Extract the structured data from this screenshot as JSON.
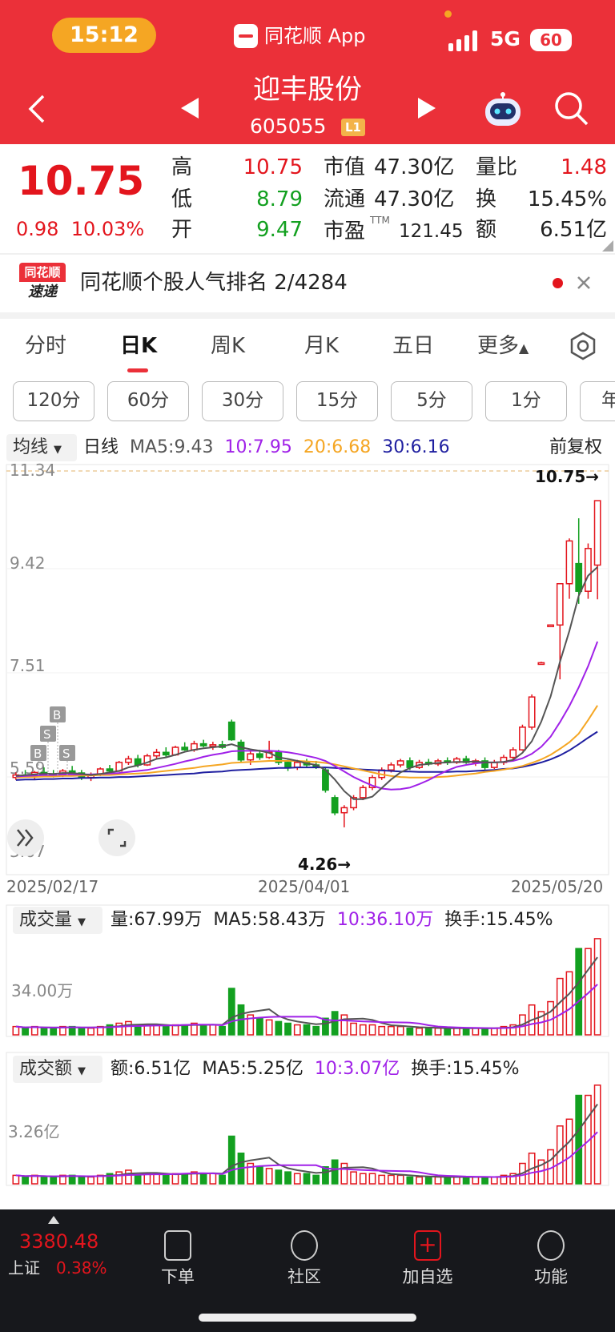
{
  "status_bar": {
    "time": "15:12",
    "app": "同花顺 App",
    "network": "5G",
    "battery": "60"
  },
  "header": {
    "name": "迎丰股份",
    "code": "605055",
    "level": "L1"
  },
  "quote": {
    "price": "10.75",
    "change": "0.98",
    "change_pct": "10.03%",
    "rows": [
      {
        "l1": "高",
        "v1": "10.75",
        "l2": "市值",
        "v2": "47.30亿",
        "l3": "量比",
        "v3": "1.48"
      },
      {
        "l1": "低",
        "v1": "8.79",
        "l2": "流通",
        "v2": "47.30亿",
        "l3": "换",
        "v3": "15.45%"
      },
      {
        "l1": "开",
        "v1": "9.47",
        "l2": "市盈",
        "l2sup": "TTM",
        "v2": "121.45",
        "l3": "额",
        "v3": "6.51亿"
      }
    ]
  },
  "banner": {
    "logo_top": "同花顺",
    "logo_bottom": "速递",
    "text": "同花顺个股人气排名 2/4284"
  },
  "tabs": [
    "分时",
    "日K",
    "周K",
    "月K",
    "五日",
    "更多"
  ],
  "periods": [
    "120分",
    "60分",
    "30分",
    "15分",
    "5分",
    "1分",
    "年"
  ],
  "ma_bar": {
    "selector": "均线",
    "type": "日线",
    "ma5": "MA5:9.43",
    "ma10": "10:7.95",
    "ma20": "20:6.68",
    "ma30": "30:6.16",
    "adjust": "前复权"
  },
  "price_chart": {
    "axis_labels": [
      "11.34",
      "9.42",
      "7.51",
      "5.59",
      "3.67"
    ],
    "max_label": "10.75→",
    "min_label": "4.26→",
    "dates": [
      "2025/02/17",
      "2025/04/01",
      "2025/05/20"
    ],
    "markers": [
      "B",
      "S",
      "B",
      "S"
    ]
  },
  "volume_panel": {
    "title": "成交量",
    "v": "量:67.99万",
    "ma5": "MA5:58.43万",
    "ma10": "10:36.10万",
    "turn": "换手:15.45%",
    "axis": "34.00万"
  },
  "amount_panel": {
    "title": "成交额",
    "v": "额:6.51亿",
    "ma5": "MA5:5.25亿",
    "ma10": "10:3.07亿",
    "turn": "换手:15.45%",
    "axis": "3.26亿"
  },
  "bottom_nav": {
    "index_value": "3380.48",
    "index_name": "上证",
    "index_pct": "0.38%",
    "items": [
      "下单",
      "社区",
      "加自选",
      "功能"
    ]
  },
  "colors": {
    "up": "#e3151d",
    "down": "#13a020",
    "ma5": "#555555",
    "ma10": "#a021e8",
    "ma20": "#f5a623",
    "ma30": "#1f1fa0",
    "header": "#eb3039"
  },
  "chart_data": {
    "type": "candlestick",
    "title": "迎丰股份 日K",
    "x_start": "2025/02/17",
    "x_end": "2025/05/20",
    "ylim": [
      3.67,
      11.34
    ],
    "ohlc": [
      [
        5.25,
        5.35,
        5.2,
        5.3
      ],
      [
        5.3,
        5.4,
        5.25,
        5.28
      ],
      [
        5.28,
        5.38,
        5.22,
        5.35
      ],
      [
        5.35,
        5.45,
        5.3,
        5.32
      ],
      [
        5.32,
        5.4,
        5.25,
        5.3
      ],
      [
        5.3,
        5.42,
        5.26,
        5.38
      ],
      [
        5.38,
        5.48,
        5.3,
        5.34
      ],
      [
        5.34,
        5.4,
        5.2,
        5.25
      ],
      [
        5.25,
        5.35,
        5.18,
        5.3
      ],
      [
        5.3,
        5.45,
        5.28,
        5.42
      ],
      [
        5.42,
        5.5,
        5.35,
        5.38
      ],
      [
        5.38,
        5.58,
        5.36,
        5.55
      ],
      [
        5.55,
        5.68,
        5.5,
        5.62
      ],
      [
        5.62,
        5.7,
        5.45,
        5.5
      ],
      [
        5.5,
        5.72,
        5.48,
        5.68
      ],
      [
        5.68,
        5.82,
        5.62,
        5.75
      ],
      [
        5.75,
        5.85,
        5.65,
        5.7
      ],
      [
        5.7,
        5.88,
        5.68,
        5.85
      ],
      [
        5.85,
        5.95,
        5.78,
        5.8
      ],
      [
        5.8,
        5.98,
        5.76,
        5.92
      ],
      [
        5.92,
        6.0,
        5.85,
        5.88
      ],
      [
        5.88,
        5.96,
        5.8,
        5.9
      ],
      [
        5.9,
        5.98,
        5.82,
        5.85
      ],
      [
        6.35,
        6.4,
        5.98,
        6.0
      ],
      [
        5.95,
        6.0,
        5.55,
        5.6
      ],
      [
        5.6,
        5.78,
        5.5,
        5.72
      ],
      [
        5.72,
        5.8,
        5.6,
        5.65
      ],
      [
        5.65,
        5.98,
        5.62,
        5.75
      ],
      [
        5.75,
        5.8,
        5.5,
        5.55
      ],
      [
        5.55,
        5.6,
        5.38,
        5.45
      ],
      [
        5.45,
        5.6,
        5.4,
        5.55
      ],
      [
        5.55,
        5.62,
        5.45,
        5.5
      ],
      [
        5.5,
        5.58,
        5.42,
        5.48
      ],
      [
        5.4,
        5.45,
        4.95,
        5.0
      ],
      [
        4.85,
        4.9,
        4.5,
        4.55
      ],
      [
        4.55,
        4.7,
        4.26,
        4.65
      ],
      [
        4.65,
        4.9,
        4.6,
        4.85
      ],
      [
        4.85,
        5.1,
        4.8,
        5.05
      ],
      [
        5.05,
        5.3,
        5.0,
        5.25
      ],
      [
        5.25,
        5.45,
        5.2,
        5.4
      ],
      [
        5.4,
        5.55,
        5.35,
        5.5
      ],
      [
        5.5,
        5.62,
        5.45,
        5.58
      ],
      [
        5.58,
        5.65,
        5.4,
        5.45
      ],
      [
        5.45,
        5.6,
        5.42,
        5.55
      ],
      [
        5.55,
        5.62,
        5.48,
        5.52
      ],
      [
        5.52,
        5.62,
        5.48,
        5.58
      ],
      [
        5.58,
        5.65,
        5.5,
        5.55
      ],
      [
        5.55,
        5.66,
        5.52,
        5.62
      ],
      [
        5.62,
        5.68,
        5.52,
        5.55
      ],
      [
        5.55,
        5.62,
        5.48,
        5.58
      ],
      [
        5.58,
        5.65,
        5.4,
        5.45
      ],
      [
        5.45,
        5.6,
        5.42,
        5.55
      ],
      [
        5.55,
        5.7,
        5.5,
        5.65
      ],
      [
        5.65,
        5.85,
        5.6,
        5.8
      ],
      [
        5.8,
        6.3,
        5.78,
        6.25
      ],
      [
        6.25,
        6.9,
        6.2,
        6.85
      ],
      [
        7.53,
        7.55,
        7.5,
        7.53
      ],
      [
        8.28,
        8.28,
        8.28,
        8.28
      ],
      [
        8.28,
        9.1,
        7.2,
        9.1
      ],
      [
        9.1,
        10.0,
        8.8,
        9.95
      ],
      [
        9.5,
        10.4,
        8.7,
        8.95
      ],
      [
        8.95,
        9.9,
        8.8,
        9.8
      ],
      [
        9.47,
        10.75,
        8.79,
        10.75
      ]
    ],
    "ma5": [
      5.28,
      5.3,
      5.31,
      5.33,
      5.32,
      5.34,
      5.34,
      5.32,
      5.3,
      5.32,
      5.35,
      5.38,
      5.45,
      5.49,
      5.55,
      5.62,
      5.65,
      5.7,
      5.76,
      5.8,
      5.83,
      5.85,
      5.87,
      5.91,
      5.85,
      5.81,
      5.78,
      5.74,
      5.65,
      5.62,
      5.58,
      5.53,
      5.5,
      5.4,
      5.21,
      4.98,
      4.82,
      4.82,
      4.87,
      5.04,
      5.21,
      5.35,
      5.44,
      5.5,
      5.52,
      5.54,
      5.55,
      5.56,
      5.56,
      5.57,
      5.55,
      5.55,
      5.56,
      5.6,
      5.74,
      5.97,
      6.36,
      6.86,
      7.55,
      8.16,
      8.86,
      9.26,
      9.43
    ],
    "ma10": [
      5.27,
      5.28,
      5.29,
      5.3,
      5.3,
      5.31,
      5.31,
      5.31,
      5.31,
      5.32,
      5.33,
      5.34,
      5.36,
      5.38,
      5.4,
      5.44,
      5.48,
      5.52,
      5.57,
      5.61,
      5.66,
      5.7,
      5.73,
      5.77,
      5.78,
      5.78,
      5.78,
      5.78,
      5.77,
      5.75,
      5.72,
      5.68,
      5.64,
      5.58,
      5.48,
      5.37,
      5.26,
      5.17,
      5.09,
      5.03,
      5.01,
      5.02,
      5.05,
      5.12,
      5.2,
      5.3,
      5.39,
      5.46,
      5.5,
      5.53,
      5.55,
      5.55,
      5.56,
      5.58,
      5.63,
      5.72,
      5.86,
      6.06,
      6.35,
      6.67,
      7.04,
      7.46,
      7.95
    ],
    "ma20": [
      5.25,
      5.26,
      5.26,
      5.27,
      5.27,
      5.28,
      5.28,
      5.29,
      5.29,
      5.3,
      5.3,
      5.31,
      5.32,
      5.33,
      5.34,
      5.36,
      5.38,
      5.4,
      5.42,
      5.44,
      5.47,
      5.49,
      5.51,
      5.54,
      5.55,
      5.56,
      5.57,
      5.58,
      5.58,
      5.58,
      5.58,
      5.57,
      5.56,
      5.54,
      5.51,
      5.47,
      5.43,
      5.39,
      5.35,
      5.31,
      5.28,
      5.26,
      5.25,
      5.25,
      5.25,
      5.26,
      5.27,
      5.29,
      5.31,
      5.33,
      5.36,
      5.38,
      5.41,
      5.44,
      5.48,
      5.54,
      5.61,
      5.7,
      5.82,
      5.95,
      6.12,
      6.39,
      6.68
    ],
    "ma30": [
      5.2,
      5.21,
      5.21,
      5.22,
      5.22,
      5.23,
      5.23,
      5.24,
      5.24,
      5.25,
      5.25,
      5.26,
      5.26,
      5.27,
      5.28,
      5.29,
      5.3,
      5.31,
      5.32,
      5.33,
      5.35,
      5.36,
      5.37,
      5.39,
      5.4,
      5.41,
      5.42,
      5.43,
      5.44,
      5.44,
      5.45,
      5.45,
      5.45,
      5.45,
      5.44,
      5.43,
      5.42,
      5.41,
      5.4,
      5.39,
      5.38,
      5.37,
      5.37,
      5.36,
      5.36,
      5.36,
      5.36,
      5.37,
      5.37,
      5.38,
      5.39,
      5.4,
      5.42,
      5.43,
      5.46,
      5.5,
      5.55,
      5.61,
      5.69,
      5.79,
      5.91,
      6.04,
      6.16
    ],
    "volume": [
      5,
      4,
      5,
      4,
      4,
      5,
      5,
      4,
      4,
      5,
      6,
      7,
      8,
      5,
      6,
      6,
      5,
      6,
      6,
      7,
      6,
      6,
      5,
      28,
      18,
      12,
      10,
      9,
      8,
      7,
      6,
      6,
      5,
      10,
      14,
      12,
      7,
      6,
      6,
      5,
      5,
      5,
      4,
      4,
      4,
      4,
      4,
      4,
      4,
      4,
      4,
      4,
      5,
      6,
      12,
      18,
      14,
      20,
      34,
      38,
      52,
      52,
      58
    ]
  }
}
